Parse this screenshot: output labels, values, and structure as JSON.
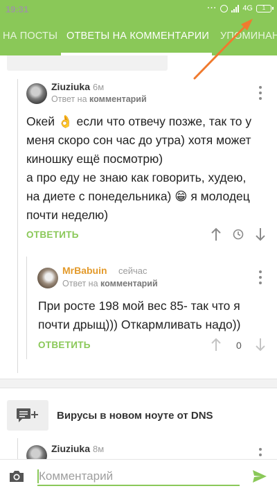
{
  "status_bar": {
    "time": "19:31",
    "network": "4G",
    "battery": "1"
  },
  "tabs": [
    {
      "label": "НА ПОСТЫ",
      "active": false
    },
    {
      "label": "ОТВЕТЫ НА КОММЕНТАРИИ",
      "active": true
    },
    {
      "label": "УПОМИНАН",
      "active": false
    }
  ],
  "colors": {
    "accent": "#8ac858",
    "annotation_arrow": "#f07a2e",
    "highlight_author": "#e39a2b"
  },
  "comments": [
    {
      "author": "Ziuziuka",
      "time": "6м",
      "reply_prefix": "Ответ на",
      "reply_target": "комментарий",
      "lines": [
        "Окей 👌 если что отвечу позже, так то у",
        "меня скоро сон час до утра) хотя может",
        "киношку ещё посмотрю)",
        "а про еду не знаю как говорить, худею,",
        "на диете с понедельника) 😁 я молодец",
        "почти неделю)"
      ],
      "reply_label": "ОТВЕТИТЬ",
      "icons": [
        "arrow-up-icon",
        "clock-icon",
        "arrow-down-icon"
      ]
    },
    {
      "author": "MrBabuin",
      "time": "сейчас",
      "reply_prefix": "Ответ на",
      "reply_target": "комментарий",
      "lines": [
        "При росте 198 мой вес 85- так что я",
        "почти дрыщ))) Откармливать надо))"
      ],
      "reply_label": "ОТВЕТИТЬ",
      "votes": "0",
      "icons": [
        "arrow-up-icon",
        "arrow-down-icon"
      ]
    }
  ],
  "post": {
    "title": "Вирусы в новом ноуте от DNS",
    "icon": "comment-add-icon"
  },
  "next_comment": {
    "author": "Ziuziuka",
    "time": "8м"
  },
  "input": {
    "placeholder": "Комментарий",
    "icons": [
      "camera-icon",
      "send-icon"
    ]
  }
}
